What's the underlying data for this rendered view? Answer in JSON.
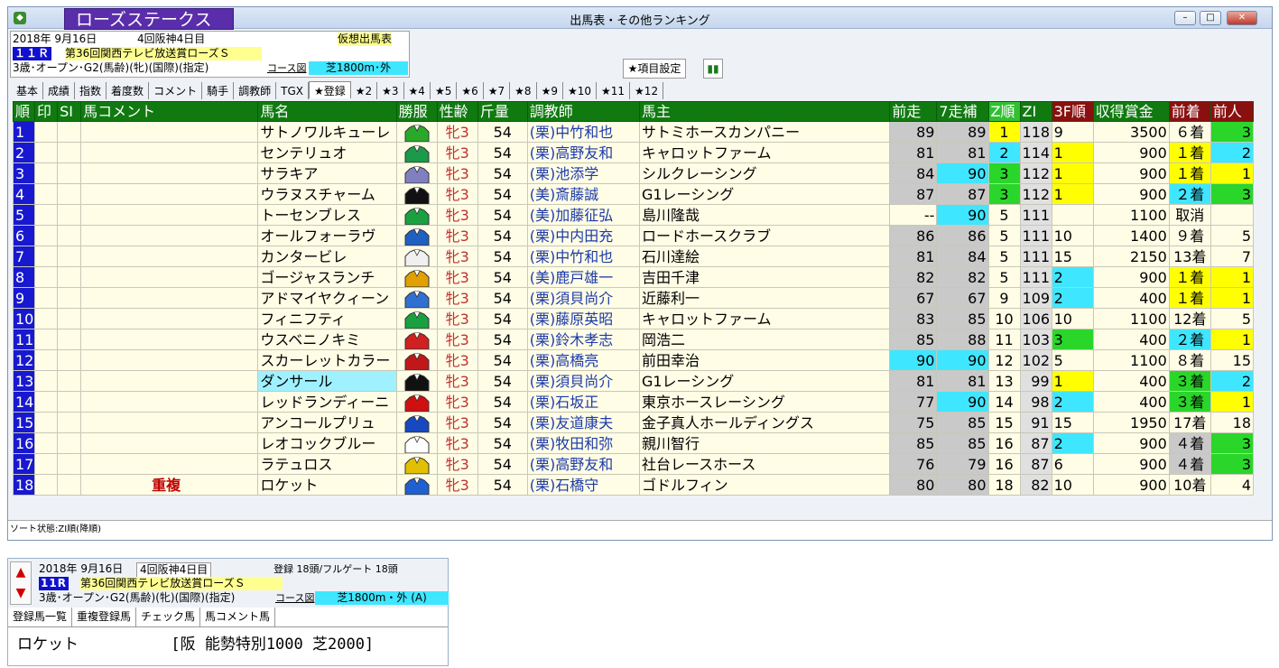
{
  "window": {
    "title": "出馬表・その他ランキング",
    "race_banner": "ローズステークス",
    "min": "–",
    "max": "□",
    "close": "✕"
  },
  "info": {
    "date": "2018年 9月16日",
    "meeting": "4回阪神4日目",
    "mode": "仮想出馬表",
    "race_no": "１１Ｒ",
    "race_name": "第36回関西テレビ放送賞ローズＳ",
    "cond": "3歳･オープン･G2(馬齢)(牝)(国際)(指定)",
    "course_label": "コース図",
    "course": "芝1800m･外"
  },
  "buttons": {
    "item_settings": "★項目設定"
  },
  "tabs": [
    "基本",
    "成績",
    "指数",
    "着度数",
    "コメント",
    "騎手",
    "調教師",
    "TGX",
    "★登録",
    "★2",
    "★3",
    "★4",
    "★5",
    "★6",
    "★7",
    "★8",
    "★9",
    "★10",
    "★11",
    "★12"
  ],
  "headers": [
    "順",
    "印",
    "SI",
    "馬コメント",
    "馬名",
    "勝服",
    "性齢",
    "斤量",
    "調教師",
    "馬主",
    "前走",
    "7走補",
    "Z順",
    "ZI",
    "3F順",
    "収得賞金",
    "前着",
    "前人"
  ],
  "rows": [
    {
      "no": "1",
      "comment": "",
      "name": "サトノワルキューレ",
      "silk": "#2aa82a",
      "age": "牝3",
      "wt": "54",
      "trainer": "(栗)中竹和也",
      "owner": "サトミホースカンパニー",
      "prev": "89",
      "p7": "89",
      "zr": "1",
      "zi": "118",
      "f3": "9",
      "prize": "3500",
      "pf": "６着",
      "pp": "3"
    },
    {
      "no": "2",
      "comment": "",
      "name": "センテリュオ",
      "silk": "#1a9a4a",
      "age": "牝3",
      "wt": "54",
      "trainer": "(栗)高野友和",
      "owner": "キャロットファーム",
      "prev": "81",
      "p7": "81",
      "zr": "2",
      "zi": "114",
      "f3": "1",
      "prize": "900",
      "pf": "１着",
      "pp": "2"
    },
    {
      "no": "3",
      "comment": "",
      "name": "サラキア",
      "silk": "#8080c0",
      "age": "牝3",
      "wt": "54",
      "trainer": "(栗)池添学",
      "owner": "シルクレーシング",
      "prev": "84",
      "p7": "90",
      "zr": "3",
      "zi": "112",
      "f3": "1",
      "prize": "900",
      "pf": "１着",
      "pp": "1"
    },
    {
      "no": "4",
      "comment": "",
      "name": "ウラヌスチャーム",
      "silk": "#111111",
      "age": "牝3",
      "wt": "54",
      "trainer": "(美)斎藤誠",
      "owner": "G1レーシング",
      "prev": "87",
      "p7": "87",
      "zr": "3",
      "zi": "112",
      "f3": "1",
      "prize": "900",
      "pf": "２着",
      "pp": "3"
    },
    {
      "no": "5",
      "comment": "",
      "name": "トーセンブレス",
      "silk": "#1aa040",
      "age": "牝3",
      "wt": "54",
      "trainer": "(美)加藤征弘",
      "owner": "島川隆哉",
      "prev": "--",
      "p7": "90",
      "zr": "5",
      "zi": "111",
      "f3": "",
      "prize": "1100",
      "pf": "取消",
      "pp": ""
    },
    {
      "no": "6",
      "comment": "",
      "name": "オールフォーラヴ",
      "silk": "#2060c0",
      "age": "牝3",
      "wt": "54",
      "trainer": "(栗)中内田充",
      "owner": "ロードホースクラブ",
      "prev": "86",
      "p7": "86",
      "zr": "5",
      "zi": "111",
      "f3": "10",
      "prize": "1400",
      "pf": "９着",
      "pp": "5"
    },
    {
      "no": "7",
      "comment": "",
      "name": "カンタービレ",
      "silk": "#f0f0f0",
      "age": "牝3",
      "wt": "54",
      "trainer": "(栗)中竹和也",
      "owner": "石川達絵",
      "prev": "81",
      "p7": "84",
      "zr": "5",
      "zi": "111",
      "f3": "15",
      "prize": "2150",
      "pf": "13着",
      "pp": "7"
    },
    {
      "no": "8",
      "comment": "",
      "name": "ゴージャスランチ",
      "silk": "#e0a000",
      "age": "牝3",
      "wt": "54",
      "trainer": "(美)鹿戸雄一",
      "owner": "吉田千津",
      "prev": "82",
      "p7": "82",
      "zr": "5",
      "zi": "111",
      "f3": "2",
      "prize": "900",
      "pf": "１着",
      "pp": "1"
    },
    {
      "no": "9",
      "comment": "",
      "name": "アドマイヤクィーン",
      "silk": "#3070d0",
      "age": "牝3",
      "wt": "54",
      "trainer": "(栗)須貝尚介",
      "owner": "近藤利一",
      "prev": "67",
      "p7": "67",
      "zr": "9",
      "zi": "109",
      "f3": "2",
      "prize": "400",
      "pf": "１着",
      "pp": "1"
    },
    {
      "no": "10",
      "comment": "",
      "name": "フィニフティ",
      "silk": "#1aa040",
      "age": "牝3",
      "wt": "54",
      "trainer": "(栗)藤原英昭",
      "owner": "キャロットファーム",
      "prev": "83",
      "p7": "85",
      "zr": "10",
      "zi": "106",
      "f3": "10",
      "prize": "1100",
      "pf": "12着",
      "pp": "5"
    },
    {
      "no": "11",
      "comment": "",
      "name": "ウスベニノキミ",
      "silk": "#d02020",
      "age": "牝3",
      "wt": "54",
      "trainer": "(栗)鈴木孝志",
      "owner": "岡浩二",
      "prev": "85",
      "p7": "88",
      "zr": "11",
      "zi": "103",
      "f3": "3",
      "prize": "400",
      "pf": "２着",
      "pp": "1"
    },
    {
      "no": "12",
      "comment": "",
      "name": "スカーレットカラー",
      "silk": "#c01818",
      "age": "牝3",
      "wt": "54",
      "trainer": "(栗)高橋亮",
      "owner": "前田幸治",
      "prev": "90",
      "p7": "90",
      "zr": "12",
      "zi": "102",
      "f3": "5",
      "prize": "1100",
      "pf": "８着",
      "pp": "15"
    },
    {
      "no": "13",
      "comment": "",
      "name": "ダンサール",
      "silk": "#111111",
      "age": "牝3",
      "wt": "54",
      "trainer": "(栗)須貝尚介",
      "owner": "G1レーシング",
      "prev": "81",
      "p7": "81",
      "zr": "13",
      "zi": "99",
      "f3": "1",
      "prize": "400",
      "pf": "３着",
      "pp": "2"
    },
    {
      "no": "14",
      "comment": "",
      "name": "レッドランディーニ",
      "silk": "#d01010",
      "age": "牝3",
      "wt": "54",
      "trainer": "(栗)石坂正",
      "owner": "東京ホースレーシング",
      "prev": "77",
      "p7": "90",
      "zr": "14",
      "zi": "98",
      "f3": "2",
      "prize": "400",
      "pf": "３着",
      "pp": "1"
    },
    {
      "no": "15",
      "comment": "",
      "name": "アンコールプリュ",
      "silk": "#1848c0",
      "age": "牝3",
      "wt": "54",
      "trainer": "(栗)友道康夫",
      "owner": "金子真人ホールディングス",
      "prev": "75",
      "p7": "85",
      "zr": "15",
      "zi": "91",
      "f3": "15",
      "prize": "1950",
      "pf": "17着",
      "pp": "18"
    },
    {
      "no": "16",
      "comment": "",
      "name": "レオコックブルー",
      "silk": "#ffffff",
      "age": "牝3",
      "wt": "54",
      "trainer": "(栗)牧田和弥",
      "owner": "親川智行",
      "prev": "85",
      "p7": "85",
      "zr": "16",
      "zi": "87",
      "f3": "2",
      "prize": "900",
      "pf": "４着",
      "pp": "3"
    },
    {
      "no": "17",
      "comment": "",
      "name": "ラテュロス",
      "silk": "#e0c000",
      "age": "牝3",
      "wt": "54",
      "trainer": "(栗)高野友和",
      "owner": "社台レースホース",
      "prev": "76",
      "p7": "79",
      "zr": "16",
      "zi": "87",
      "f3": "6",
      "prize": "900",
      "pf": "４着",
      "pp": "3"
    },
    {
      "no": "18",
      "comment": "重複",
      "name": "ロケット",
      "silk": "#2060d0",
      "age": "牝3",
      "wt": "54",
      "trainer": "(栗)石橋守",
      "owner": "ゴドルフィン",
      "prev": "80",
      "p7": "80",
      "zr": "18",
      "zi": "82",
      "f3": "10",
      "prize": "900",
      "pf": "10着",
      "pp": "4"
    }
  ],
  "status": "ソート状態:ZI順(降順)",
  "bottom": {
    "up": "▲",
    "down": "▼",
    "date": "2018年 9月16日",
    "meeting": "4回阪神4日目",
    "entries": "登録 18頭/フルゲート 18頭",
    "race_no": "11R",
    "race_name": "第36回関西テレビ放送賞ローズＳ",
    "cond": "3歳･オープン･G2(馬齢)(牝)(国際)(指定)",
    "course_label": "コース図",
    "course": "芝1800m・外 (A)",
    "tabs": [
      "登録馬一覧",
      "重複登録馬",
      "チェック馬",
      "馬コメント馬"
    ],
    "content": "ロケット          [阪 能勢特別1000 芝2000]"
  }
}
